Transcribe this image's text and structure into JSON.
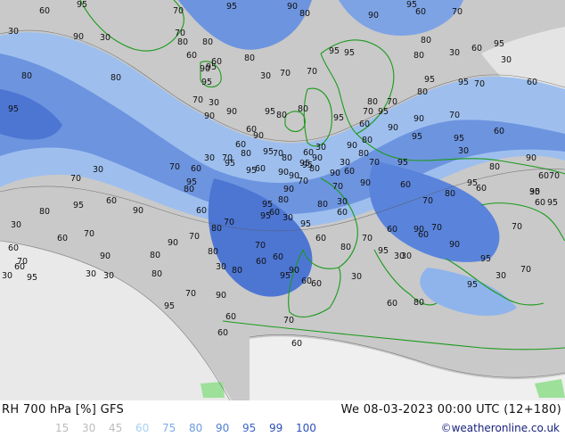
{
  "map": {
    "contour_labels": [
      "60",
      "30",
      "95",
      "90",
      "80",
      "95",
      "70",
      "80",
      "90",
      "95",
      "30",
      "70",
      "60",
      "80",
      "95",
      "80",
      "60",
      "95",
      "30",
      "70",
      "80",
      "90",
      "30",
      "70",
      "90",
      "95",
      "80",
      "60",
      "70",
      "60",
      "95",
      "90",
      "80",
      "90",
      "80",
      "95",
      "70",
      "95",
      "90",
      "95",
      "60",
      "70",
      "80",
      "80",
      "30",
      "60",
      "95",
      "30",
      "95",
      "70",
      "60",
      "95",
      "80",
      "70",
      "80",
      "95",
      "80",
      "90",
      "90",
      "70",
      "95",
      "30",
      "60",
      "90",
      "70",
      "95",
      "95",
      "80",
      "60",
      "95",
      "80",
      "70",
      "60",
      "90",
      "90",
      "60",
      "80",
      "70",
      "30",
      "95",
      "95",
      "90",
      "60",
      "70",
      "95",
      "30",
      "95",
      "60",
      "70",
      "90",
      "80",
      "60",
      "30",
      "95",
      "60",
      "80",
      "95",
      "60",
      "80",
      "70",
      "95",
      "30",
      "60",
      "30",
      "60",
      "70",
      "90",
      "95",
      "70",
      "30",
      "60",
      "60",
      "70",
      "30",
      "95",
      "80",
      "60",
      "30",
      "60",
      "90",
      "60",
      "70",
      "60",
      "80",
      "30",
      "80",
      "70",
      "80",
      "60",
      "70",
      "90",
      "80",
      "80",
      "70",
      "95",
      "90",
      "60",
      "60",
      "70",
      "60",
      "60",
      "95",
      "95",
      "95",
      "90",
      "80",
      "90",
      "70",
      "30",
      "95",
      "80",
      "60",
      "90",
      "95",
      "70",
      "80",
      "90",
      "60",
      "80",
      "95",
      "70",
      "30",
      "90",
      "60",
      "30",
      "70",
      "95",
      "80",
      "30",
      "60",
      "70",
      "95",
      "60",
      "70",
      "90",
      "30",
      "30",
      "60",
      "30"
    ]
  },
  "footer": {
    "title": "RH 700 hPa [%] GFS",
    "run_time": "We 08-03-2023 00:00 UTC (12+180)",
    "credit": "©weatheronline.co.uk",
    "legend": [
      {
        "label": "15",
        "color": "#bcbcbc"
      },
      {
        "label": "30",
        "color": "#bcbcbc"
      },
      {
        "label": "45",
        "color": "#bcbcbc"
      },
      {
        "label": "60",
        "color": "#a8d1f2"
      },
      {
        "label": "75",
        "color": "#7faee8"
      },
      {
        "label": "80",
        "color": "#6a9ae0"
      },
      {
        "label": "90",
        "color": "#4f7fd6"
      },
      {
        "label": "95",
        "color": "#3b66c8"
      },
      {
        "label": "99",
        "color": "#2a4fb8"
      },
      {
        "label": "100",
        "color": "#2a4fb8"
      }
    ]
  },
  "colors": {
    "dry": "#c8c8c8",
    "very_dry": "#f0f0f0",
    "moist": "#8fb4ec",
    "wet": "#5d86db",
    "saturated": "#3c63cc",
    "coastline": "#1a9a1a",
    "land_dry": "#9de09a"
  }
}
